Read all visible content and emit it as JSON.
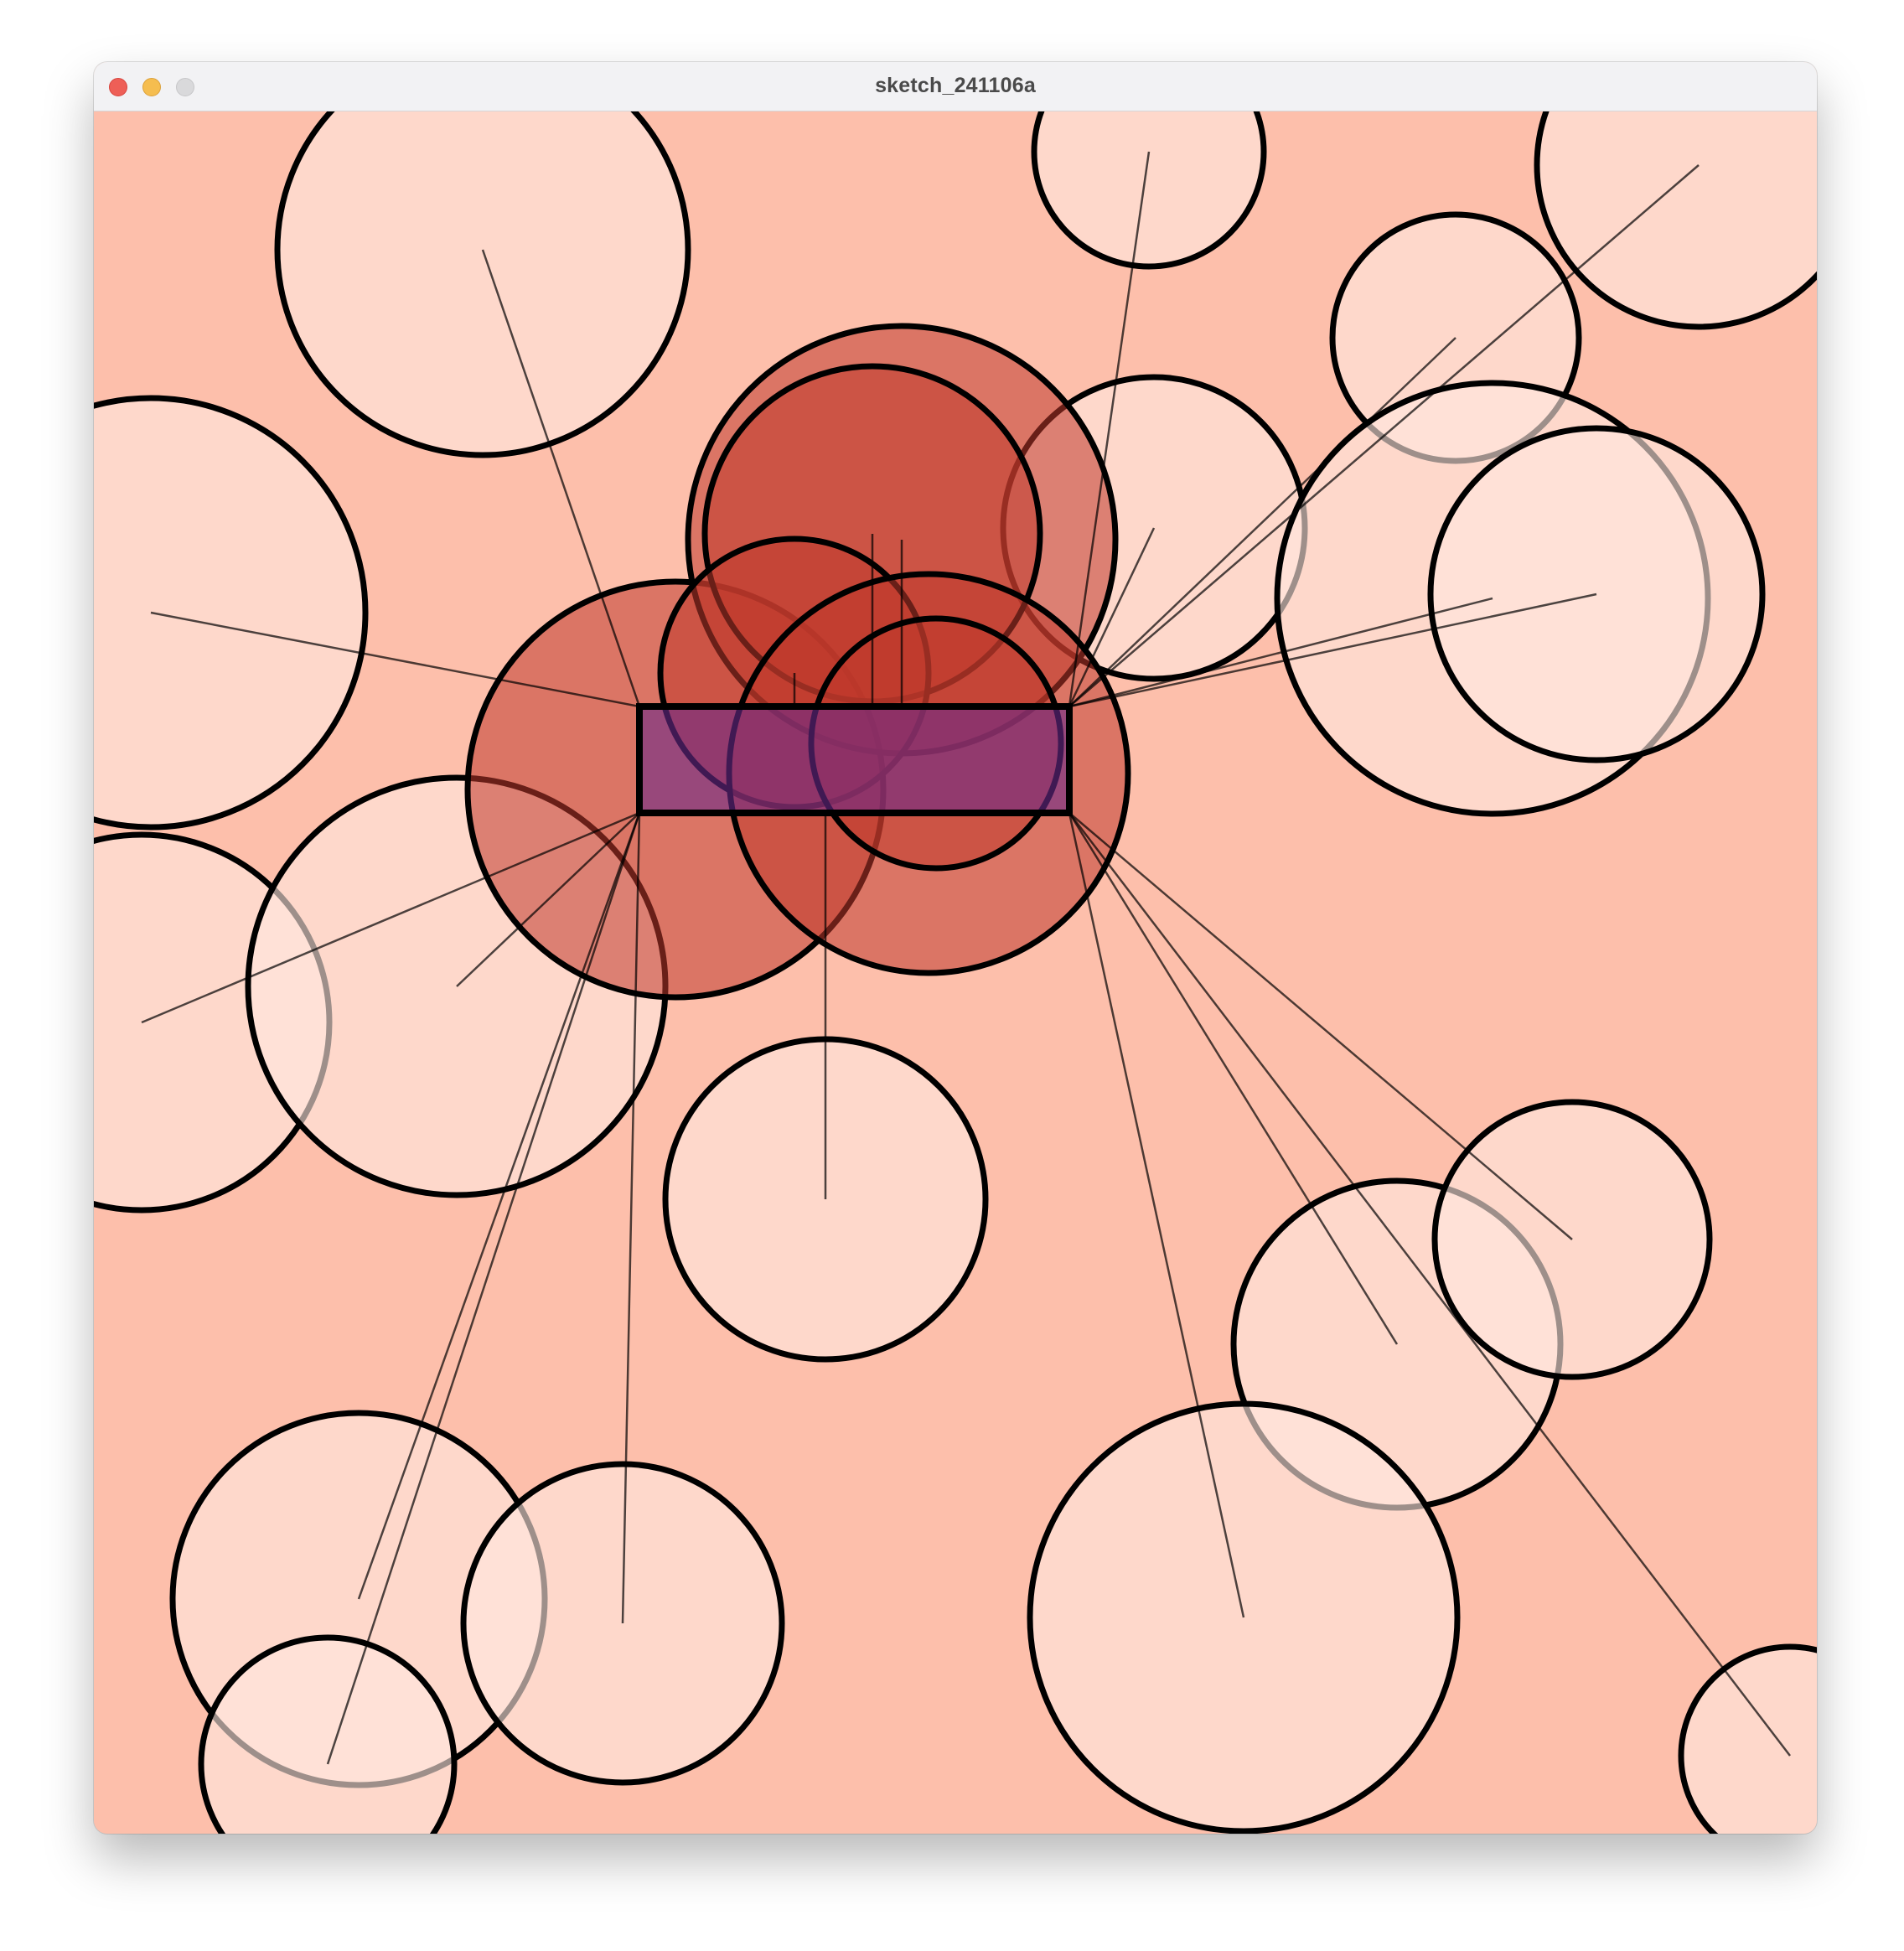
{
  "window": {
    "title": "sketch_241106a"
  },
  "canvas": {
    "background": "#fdbfab",
    "panel_color": "#fdbfab",
    "circle_fill_light": "#ffe8e0",
    "circle_fill_red": "#c0392b",
    "rect_fill": "#7a2a7a",
    "stroke": "#000000"
  }
}
